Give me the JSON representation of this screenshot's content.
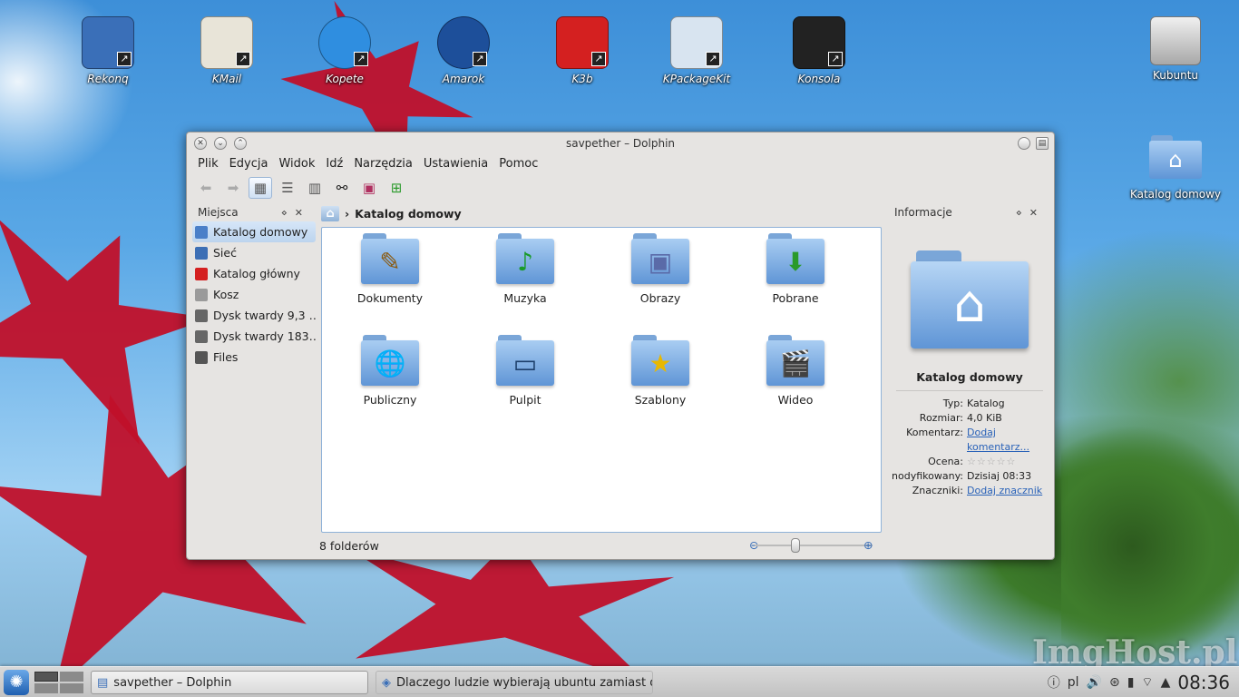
{
  "desktop": {
    "top_icons": [
      {
        "label": "Rekonq",
        "icon": "rekonq-icon"
      },
      {
        "label": "KMail",
        "icon": "kmail-icon"
      },
      {
        "label": "Kopete",
        "icon": "kopete-icon"
      },
      {
        "label": "Amarok",
        "icon": "amarok-icon"
      },
      {
        "label": "K3b",
        "icon": "k3b-icon"
      },
      {
        "label": "KPackageKit",
        "icon": "kpackagekit-icon"
      },
      {
        "label": "Konsola",
        "icon": "terminal-icon"
      }
    ],
    "right_icons": [
      {
        "label": "Kubuntu",
        "icon": "hard-drive-icon"
      },
      {
        "label": "Katalog domowy",
        "icon": "home-folder-icon"
      }
    ],
    "watermark": "ImgHost.pl"
  },
  "window": {
    "title": "savpether – Dolphin",
    "menu": [
      "Plik",
      "Edycja",
      "Widok",
      "Idź",
      "Narzędzia",
      "Ustawienia",
      "Pomoc"
    ],
    "places_panel": {
      "title": "Miejsca",
      "items": [
        {
          "label": "Katalog domowy",
          "color": "#4a7fc8"
        },
        {
          "label": "Sieć",
          "color": "#3d6fb5"
        },
        {
          "label": "Katalog główny",
          "color": "#d42020"
        },
        {
          "label": "Kosz",
          "color": "#9a9a9a"
        },
        {
          "label": "Dysk twardy 9,3 …",
          "color": "#666666"
        },
        {
          "label": "Dysk twardy 183…",
          "color": "#666666"
        },
        {
          "label": "Files",
          "color": "#555555"
        }
      ]
    },
    "breadcrumb": "Katalog domowy",
    "folders": [
      {
        "label": "Dokumenty",
        "emblem": "pencil-icon",
        "glyph": "✎"
      },
      {
        "label": "Muzyka",
        "emblem": "music-note-icon",
        "glyph": "♪"
      },
      {
        "label": "Obrazy",
        "emblem": "picture-icon",
        "glyph": "▣"
      },
      {
        "label": "Pobrane",
        "emblem": "download-arrow-icon",
        "glyph": "⬇"
      },
      {
        "label": "Publiczny",
        "emblem": "globe-icon",
        "glyph": "🌐"
      },
      {
        "label": "Pulpit",
        "emblem": "desktop-icon",
        "glyph": "▭"
      },
      {
        "label": "Szablony",
        "emblem": "star-icon",
        "glyph": "★"
      },
      {
        "label": "Wideo",
        "emblem": "clapperboard-icon",
        "glyph": "🎬"
      }
    ],
    "status": "8 folderów",
    "info_panel": {
      "title": "Informacje",
      "name": "Katalog domowy",
      "rows": [
        {
          "key": "Typ:",
          "value": "Katalog",
          "link": false
        },
        {
          "key": "Rozmiar:",
          "value": "4,0 KiB",
          "link": false
        },
        {
          "key": "Komentarz:",
          "value": "Dodaj komentarz...",
          "link": true
        },
        {
          "key": "Ocena:",
          "value": "☆☆☆☆☆",
          "link": false
        },
        {
          "key": "nodyfikowany:",
          "value": "Dzisiaj 08:33",
          "link": false
        },
        {
          "key": "Znaczniki:",
          "value": "Dodaj znacznik",
          "link": true
        }
      ]
    }
  },
  "taskbar": {
    "tasks": [
      "savpether – Dolphin",
      "Dlaczego ludzie wybierają ubuntu zamiast open"
    ],
    "keyboard_layout": "pl",
    "clock": "08:36"
  },
  "colors": {
    "accent": "#4a7fc8",
    "link": "#2a62b8",
    "selection": "#bcd4ee"
  }
}
